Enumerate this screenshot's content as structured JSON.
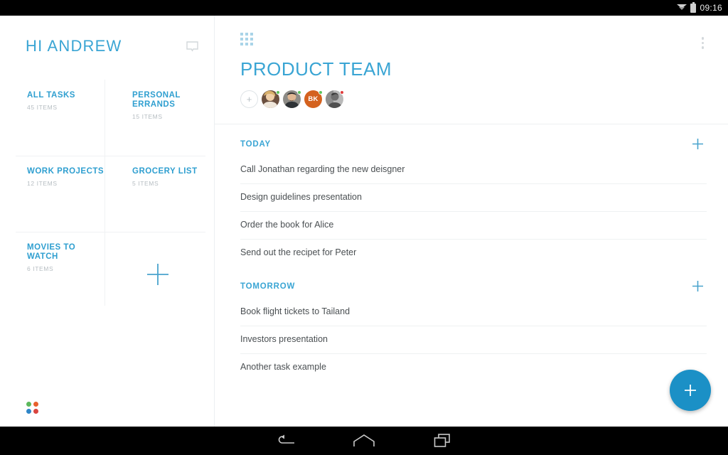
{
  "statusbar": {
    "clock": "09:16",
    "wifi_icon": "wifi-icon",
    "battery_icon": "battery-icon"
  },
  "navbar": {
    "back_icon": "back-arrow-icon",
    "home_icon": "home-icon",
    "recents_icon": "recents-icon"
  },
  "sidebar": {
    "greeting": "HI ANDREW",
    "chat_icon": "chat-bubble-icon",
    "add_list_icon": "plus-icon",
    "brand_logo": "four-dot-logo",
    "brand_colors": [
      "#5cb85c",
      "#e8602c",
      "#2f86c8",
      "#d9443f"
    ],
    "tiles": [
      {
        "title": "ALL TASKS",
        "count": "45 ITEMS"
      },
      {
        "title": "PERSONAL ERRANDS",
        "count": "15 ITEMS"
      },
      {
        "title": "WORK PROJECTS",
        "count": "12 ITEMS"
      },
      {
        "title": "GROCERY LIST",
        "count": "5 ITEMS"
      },
      {
        "title": "MOVIES TO WATCH",
        "count": "6 ITEMS"
      }
    ]
  },
  "main": {
    "grid_icon": "grid-apps-icon",
    "overflow_icon": "overflow-menu-icon",
    "title": "PRODUCT TEAM",
    "add_member_label": "+",
    "members": [
      {
        "name": "member-avatar-1",
        "type": "photo",
        "status": "#5cc45c"
      },
      {
        "name": "member-avatar-2",
        "type": "photo",
        "status": "#5cc45c"
      },
      {
        "name": "member-avatar-3",
        "type": "initials",
        "initials": "BK",
        "color": "#d4621f",
        "status": "#5cc45c"
      },
      {
        "name": "member-avatar-4",
        "type": "photo",
        "status": "#e03b3b"
      }
    ],
    "sections": [
      {
        "label": "TODAY",
        "add_icon": "plus-icon",
        "tasks": [
          "Call Jonathan regarding the new deisgner",
          "Design guidelines presentation",
          "Order the book for Alice",
          "Send out the recipet for Peter"
        ]
      },
      {
        "label": "TOMORROW",
        "add_icon": "plus-icon",
        "tasks": [
          "Book flight tickets to Tailand",
          "Investors presentation",
          "Another task example"
        ]
      }
    ],
    "fab_icon": "plus-icon"
  },
  "colors": {
    "accent": "#3aa5d4",
    "fab": "#1b90c6",
    "text": "#4a4f52",
    "muted": "#b6bdc2"
  }
}
